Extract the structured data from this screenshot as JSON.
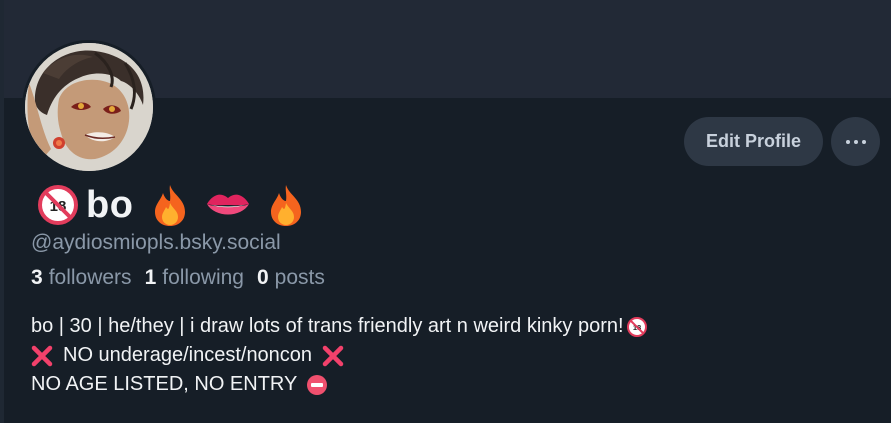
{
  "profile": {
    "display_name": "bo",
    "handle": "@aydiosmiopls.bsky.social",
    "name_icons": [
      "no-under-18-icon",
      "fire-icon",
      "lips-icon",
      "fire-icon"
    ]
  },
  "actions": {
    "edit_profile": "Edit Profile",
    "more_icon": "more-options-icon"
  },
  "stats": {
    "followers_count": "3",
    "followers_label": "followers",
    "following_count": "1",
    "following_label": "following",
    "posts_count": "0",
    "posts_label": "posts"
  },
  "bio": {
    "line1": "bo | 30 | he/they | i draw lots of trans friendly art n weird kinky porn!",
    "line2": "NO underage/incest/noncon",
    "line3": "NO AGE LISTED, NO ENTRY"
  },
  "colors": {
    "page_bg": "#161e27",
    "banner_bg": "#222936",
    "button_bg": "#2e3845",
    "muted_text": "#8a98a8",
    "primary_text": "#f1f3f5"
  }
}
